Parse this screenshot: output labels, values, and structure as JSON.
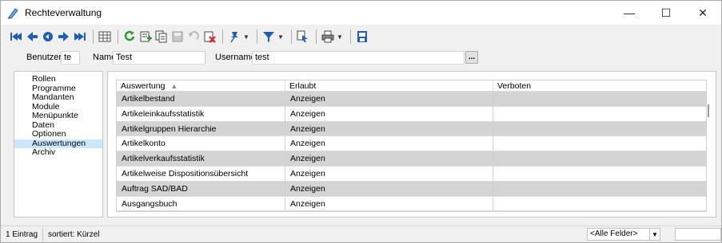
{
  "window": {
    "title": "Rechteverwaltung",
    "controls": {
      "minimize": "—",
      "maximize": "☐",
      "close": "✕"
    }
  },
  "toolbar": {
    "icons": [
      "first-record-icon",
      "prev-record-icon",
      "back-icon",
      "next-record-icon",
      "last-record-icon",
      "table-view-icon",
      "refresh-icon",
      "new-icon",
      "copy-icon",
      "save-icon",
      "undo-icon",
      "delete-icon",
      "pin-icon",
      "filter-icon",
      "select-icon",
      "print-icon",
      "export-icon"
    ]
  },
  "filter": {
    "benutzer_label": "Benutzer",
    "benutzer_value": "te",
    "name_label": "Name",
    "name_value": "Test",
    "username_label": "Username",
    "username_value": "test",
    "lookup_label": "..."
  },
  "nav": {
    "items": [
      "Rollen",
      "Programme",
      "Mandanten",
      "Module",
      "Menüpunkte",
      "Daten",
      "Optionen",
      "Auswertungen",
      "Archiv"
    ],
    "selected": "Auswertungen"
  },
  "grid": {
    "columns": [
      "Auswertung",
      "Erlaubt",
      "Verboten"
    ],
    "sort_indicator": "▲",
    "rows": [
      {
        "name": "Artikelbestand",
        "erlaubt": "Anzeigen",
        "verboten": ""
      },
      {
        "name": "Artikeleinkaufsstatistik",
        "erlaubt": "Anzeigen",
        "verboten": ""
      },
      {
        "name": "Artikelgruppen Hierarchie",
        "erlaubt": "Anzeigen",
        "verboten": ""
      },
      {
        "name": "Artikelkonto",
        "erlaubt": "Anzeigen",
        "verboten": ""
      },
      {
        "name": "Artikelverkaufsstatistik",
        "erlaubt": "Anzeigen",
        "verboten": ""
      },
      {
        "name": "Artikelweise Dispositionsübersicht",
        "erlaubt": "Anzeigen",
        "verboten": ""
      },
      {
        "name": "Auftrag SAD/BAD",
        "erlaubt": "Anzeigen",
        "verboten": ""
      },
      {
        "name": "Ausgangsbuch",
        "erlaubt": "Anzeigen",
        "verboten": ""
      }
    ]
  },
  "status": {
    "count": "1 Eintrag",
    "sort": "sortiert: Kürzel",
    "field_selector": "<Alle Felder>"
  },
  "colors": {
    "selected_bg": "#cce8ff",
    "row_shade": "#d4d4d4",
    "accent_blue": "#1e5fb4"
  }
}
